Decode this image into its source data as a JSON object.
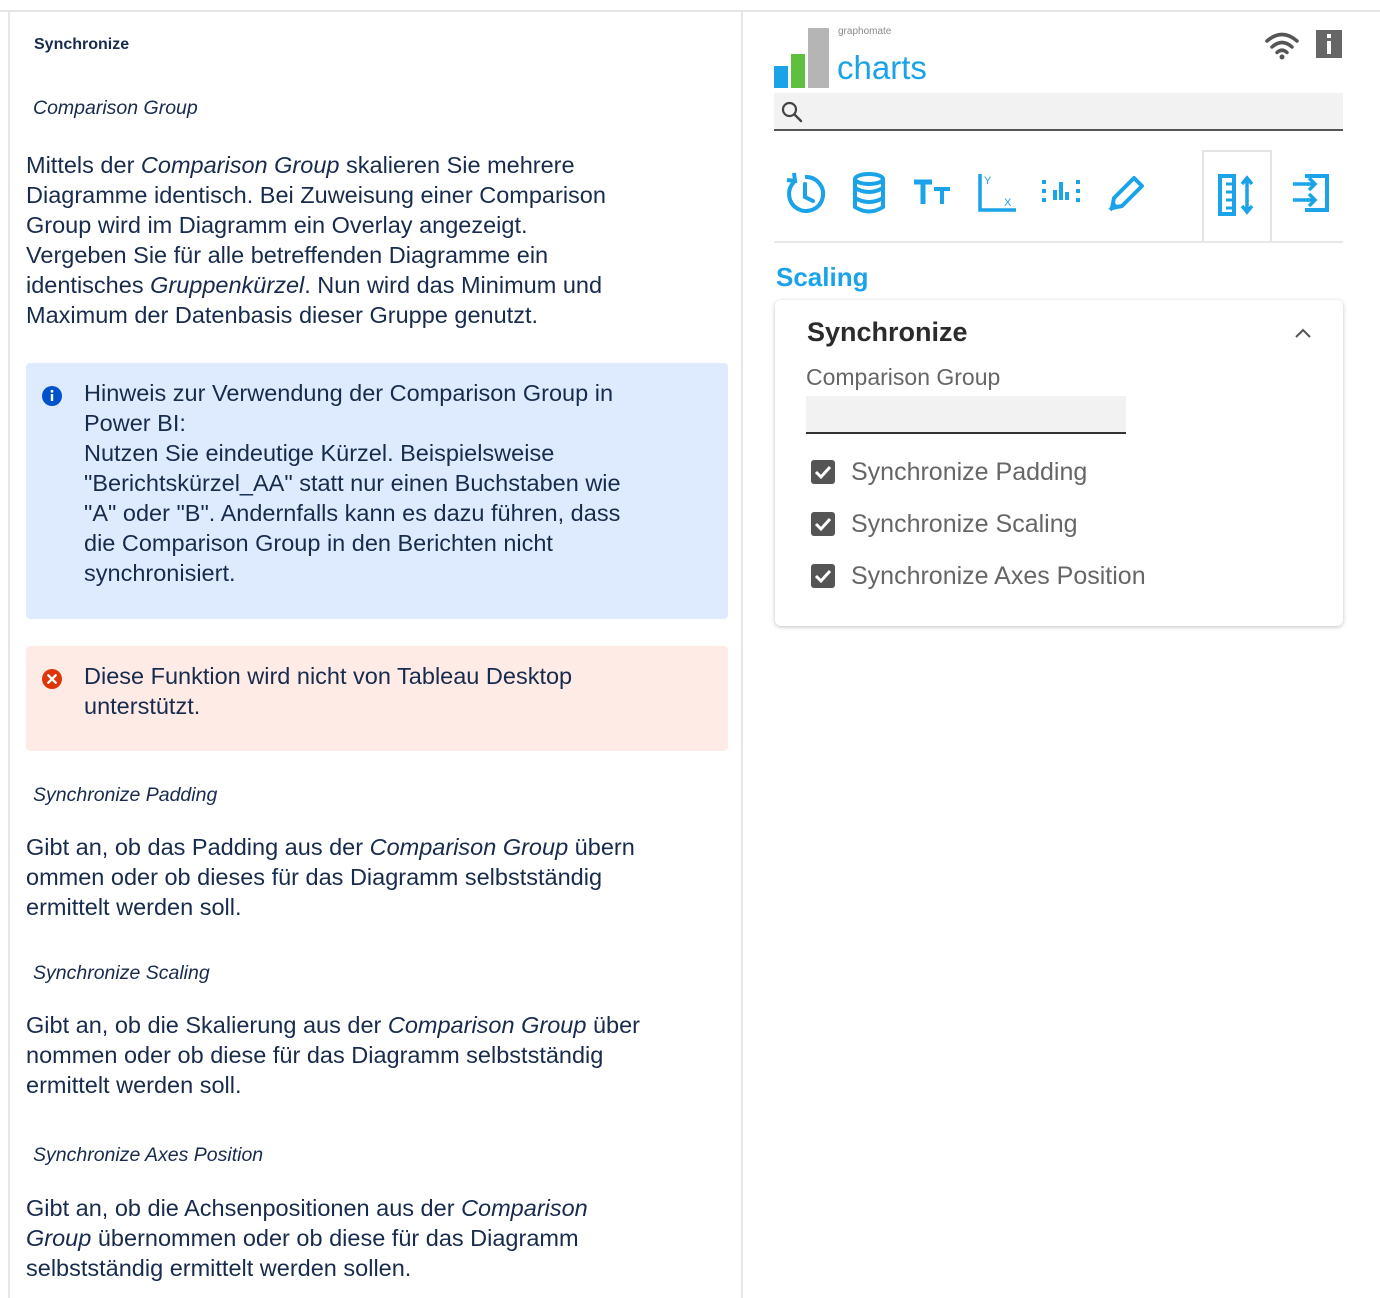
{
  "doc": {
    "title": "Synchronize",
    "comparison_group": {
      "heading": "Comparison Group",
      "body_html_parts": {
        "l1_a": "Mittels der ",
        "l1_i": "Comparison Group",
        "l1_b": " skalieren Sie mehrere",
        "l2": "Diagramme identisch. Bei Zuweisung einer Comparison",
        "l3": "Group wird im Diagramm ein Overlay angezeigt.",
        "l4": "Vergeben Sie für alle betreffenden Diagramme ein",
        "l5_a": "identisches ",
        "l5_i": "Gruppenkürzel",
        "l5_b": ". Nun wird das Minimum und",
        "l6": "Maximum der Datenbasis dieser Gruppe genutzt."
      }
    },
    "info_note": {
      "l1": "Hinweis zur Verwendung der Comparison Group in",
      "l2": "Power BI:",
      "l3": "Nutzen Sie eindeutige Kürzel. Beispielsweise",
      "l4": "\"Berichtskürzel_AA\" statt nur einen Buchstaben wie",
      "l5": "\"A\" oder \"B\". Andernfalls kann es dazu führen, dass",
      "l6": "die Comparison Group in den Berichten nicht",
      "l7": "synchronisiert."
    },
    "error_note": {
      "l1": "Diese Funktion wird nicht von Tableau Desktop",
      "l2": "unterstützt."
    },
    "sync_padding": {
      "heading": "Synchronize Padding",
      "l1_a": "Gibt an, ob das Padding aus der ",
      "l1_i": "Comparison Group",
      "l1_b": " übern",
      "l2": "ommen oder ob dieses für das Diagramm selbstständig",
      "l3": "ermittelt werden soll."
    },
    "sync_scaling": {
      "heading": "Synchronize Scaling",
      "l1_a": "Gibt an, ob die Skalierung aus der ",
      "l1_i": "Comparison Group",
      "l1_b": " über",
      "l2": "nommen oder ob diese für das Diagramm selbstständig",
      "l3": "ermittelt werden soll."
    },
    "sync_axes": {
      "heading": "Synchronize Axes Position",
      "l1_a": "Gibt an, ob die Achsenpositionen aus der ",
      "l1_i": "Comparison",
      "l2_i": "Group",
      "l2_b": " übernommen oder ob diese für das Diagramm",
      "l3": "selbstständig ermittelt werden sollen."
    }
  },
  "panel": {
    "logo_small": "graphomate",
    "logo_big": "charts",
    "search_value": "",
    "tabs": [
      "data-refresh-icon",
      "database-icon",
      "text-size-icon",
      "axis-icon",
      "chart-points-icon",
      "pen-icon",
      "scaling-icon",
      "layout-icon"
    ],
    "active_tab": 6,
    "section_title": "Scaling",
    "card": {
      "title": "Synchronize",
      "field_label": "Comparison Group",
      "field_value": "",
      "checks": [
        {
          "label": "Synchronize Padding",
          "checked": true
        },
        {
          "label": "Synchronize Scaling",
          "checked": true
        },
        {
          "label": "Synchronize Axes Position",
          "checked": true
        }
      ]
    }
  },
  "colors": {
    "accent": "#1aa3e8",
    "info_bg": "#deebff",
    "error_bg": "#ffebe6",
    "info_icon": "#0052cc",
    "error_icon": "#de350b",
    "logo_bar_blue": "#1aa3e8",
    "logo_bar_green": "#5fbf3f",
    "logo_bar_gray": "#b5b5b5"
  }
}
